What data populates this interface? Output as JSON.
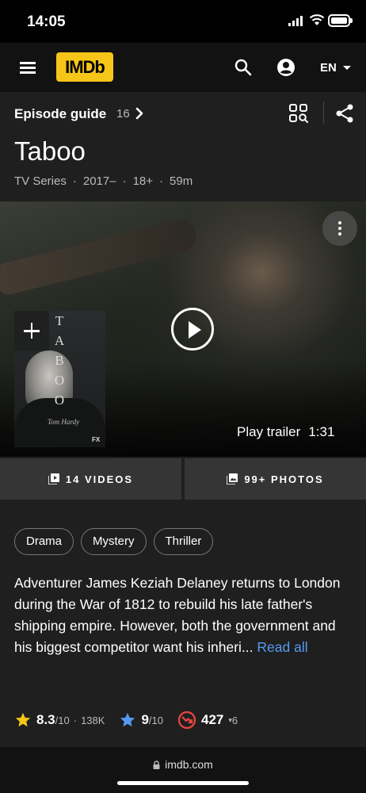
{
  "status_bar": {
    "time": "14:05"
  },
  "navbar": {
    "logo": "IMDb",
    "language": "EN"
  },
  "episode_guide": {
    "label": "Episode guide",
    "count": "16"
  },
  "title": "Taboo",
  "meta": {
    "type": "TV Series",
    "years": "2017–",
    "rating": "18+",
    "runtime": "59m"
  },
  "hero": {
    "trailer_label": "Play trailer",
    "trailer_duration": "1:31",
    "poster_letters": [
      "T",
      "A",
      "B",
      "O",
      "O"
    ],
    "poster_signature": "Tom Hardy",
    "poster_network": "FX"
  },
  "media": {
    "videos_label": "14 VIDEOS",
    "photos_label": "99+ PHOTOS"
  },
  "genres": [
    "Drama",
    "Mystery",
    "Thriller"
  ],
  "plot": {
    "text": "Adventurer James Keziah Delaney returns to London during the War of 1812 to rebuild his late father's shipping empire. However, both the government and his biggest competitor want his inheri...",
    "read_all": "Read all"
  },
  "ratings": {
    "imdb_value": "8.3",
    "imdb_scale": "/10",
    "imdb_votes": "138K",
    "user_value": "9",
    "user_scale": "/10",
    "popularity": "427",
    "popularity_change": "6"
  },
  "footer": {
    "url": "imdb.com"
  },
  "colors": {
    "brand": "#f5c518",
    "link": "#5799ef",
    "user_star": "#5799ef",
    "popularity": "#e0443e"
  }
}
